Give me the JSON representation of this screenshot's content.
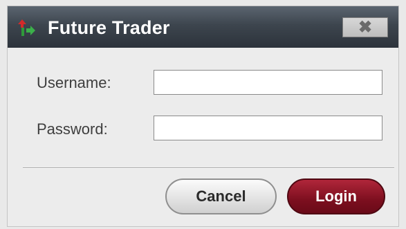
{
  "window": {
    "title": "Future Trader",
    "icon": "future-trader-logo-icon",
    "close_glyph": "✖"
  },
  "form": {
    "username_label": "Username:",
    "username_value": "",
    "password_label": "Password:",
    "password_value": ""
  },
  "buttons": {
    "cancel_label": "Cancel",
    "login_label": "Login"
  },
  "colors": {
    "titlebar": "#3d454e",
    "login_button": "#7d0f1f",
    "background": "#ececec"
  }
}
